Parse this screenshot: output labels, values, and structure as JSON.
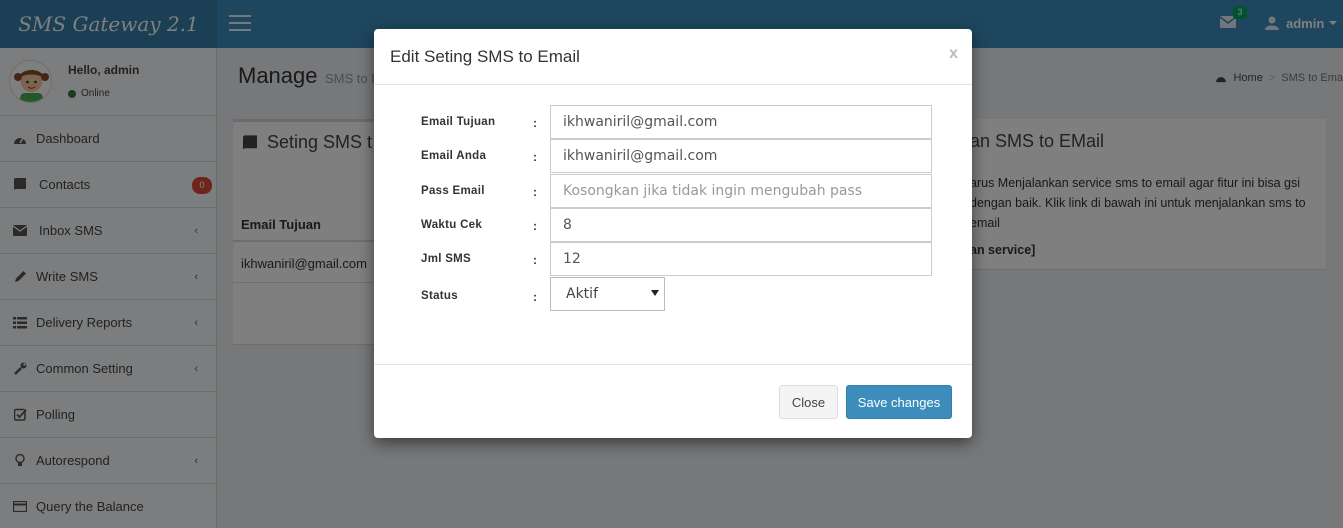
{
  "app": {
    "logo": "SMS Gateway 2.1",
    "mail_count": "3",
    "user_name": "admin"
  },
  "sidebar": {
    "greeting": "Hello, admin",
    "status": "Online",
    "items": [
      {
        "label": "Dashboard",
        "icon": "dashboard-icon"
      },
      {
        "label": "Contacts",
        "icon": "book-icon",
        "badge": "0"
      },
      {
        "label": "Inbox SMS",
        "icon": "envelope-icon"
      },
      {
        "label": "Write SMS",
        "icon": "pencil-icon"
      },
      {
        "label": "Delivery Reports",
        "icon": "list-icon"
      },
      {
        "label": "Common Setting",
        "icon": "wrench-icon"
      },
      {
        "label": "Polling",
        "icon": "checkbox-icon"
      },
      {
        "label": "Autorespond",
        "icon": "lightbulb-icon"
      },
      {
        "label": "Query the Balance",
        "icon": "credit-card-icon"
      }
    ]
  },
  "page": {
    "title": "Manage",
    "subtitle": "SMS to E",
    "breadcrumb_home": "Home",
    "breadcrumb_sep": ">",
    "breadcrumb_current": "SMS to Ema"
  },
  "left_box": {
    "title": "Seting SMS t",
    "column_header": "Email Tujuan",
    "row_value": "ikhwaniril@gmail.com"
  },
  "right_box": {
    "title": "an SMS to EMail",
    "text": "arus Menjalankan service sms to email agar fitur ini bisa gsi dengan baik. Klik link di bawah ini untuk menjalankan sms to email",
    "link": "an service]"
  },
  "modal": {
    "title": "Edit Seting SMS to Email",
    "close_x": "x",
    "colon": ":",
    "fields": {
      "email_tujuan": {
        "label": "Email Tujuan",
        "value": "ikhwaniril@gmail.com"
      },
      "email_anda": {
        "label": "Email Anda",
        "value": "ikhwaniril@gmail.com"
      },
      "pass_email": {
        "label": "Pass Email",
        "value": "",
        "placeholder": "Kosongkan jika tidak ingin mengubah pass"
      },
      "waktu_cek": {
        "label": "Waktu Cek",
        "value": "8"
      },
      "jml_sms": {
        "label": "Jml SMS",
        "value": "12"
      },
      "status": {
        "label": "Status",
        "value": "Aktif"
      }
    },
    "close_button": "Close",
    "save_button": "Save changes"
  },
  "colors": {
    "header": "#3c8dbc",
    "logo_bg": "#367fa9",
    "primary_button": "#3c8dbc",
    "badge_red": "#dd4b39",
    "badge_green": "#00a65a"
  }
}
